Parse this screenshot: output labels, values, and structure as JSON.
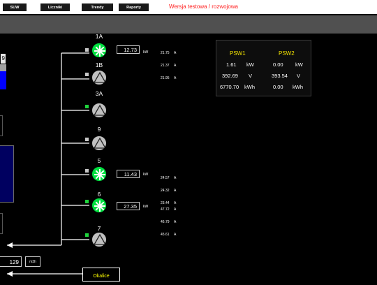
{
  "nav": {
    "buttons": [
      "SUW",
      "Liczniki",
      "Trendy",
      "Raporty"
    ],
    "env_label": "Wersja testowa / rozwojowa"
  },
  "left": {
    "level_value": "9",
    "flow_value": "129",
    "flow_unit": "m3h"
  },
  "okalice_label": "Okalice",
  "pumps": [
    {
      "name": "1A",
      "state": "on",
      "indicator": "grey",
      "power": "12.73",
      "power_unit": "kW",
      "currents": [
        "21.75",
        "21.37",
        "21.95"
      ],
      "current_unit": "A"
    },
    {
      "name": "1B",
      "state": "off",
      "indicator": "grey"
    },
    {
      "name": "3A",
      "state": "off",
      "indicator": "green"
    },
    {
      "name": "9",
      "state": "off",
      "indicator": "grey"
    },
    {
      "name": "5",
      "state": "on",
      "indicator": "grey",
      "power": "11.43",
      "power_unit": "kW",
      "currents": [
        "24.57",
        "24.32",
        "23.44"
      ],
      "current_unit": "A"
    },
    {
      "name": "6",
      "state": "on",
      "indicator": "green",
      "power": "27.35",
      "power_unit": "kW",
      "currents": [
        "47.72",
        "46.79",
        "45.61"
      ],
      "current_unit": "A"
    },
    {
      "name": "7",
      "state": "off",
      "indicator": "green"
    }
  ],
  "psw": {
    "headers": [
      "PSW1",
      "PSW2"
    ],
    "rows": [
      {
        "v1": "1.61",
        "u1": "kW",
        "v2": "0.00",
        "u2": "kW"
      },
      {
        "v1": "392.69",
        "u1": "V",
        "v2": "393.54",
        "u2": "V"
      },
      {
        "v1": "6770.70",
        "u1": "kWh",
        "v2": "0.00",
        "u2": "kWh"
      }
    ]
  },
  "colors": {
    "pump_on": "#00e040",
    "pump_off": "#c0c0c0",
    "indicator_green": "#1fd43c",
    "env_label": "#ff2020",
    "psw_header": "#f0e000",
    "okalice_label": "#ffff00"
  }
}
